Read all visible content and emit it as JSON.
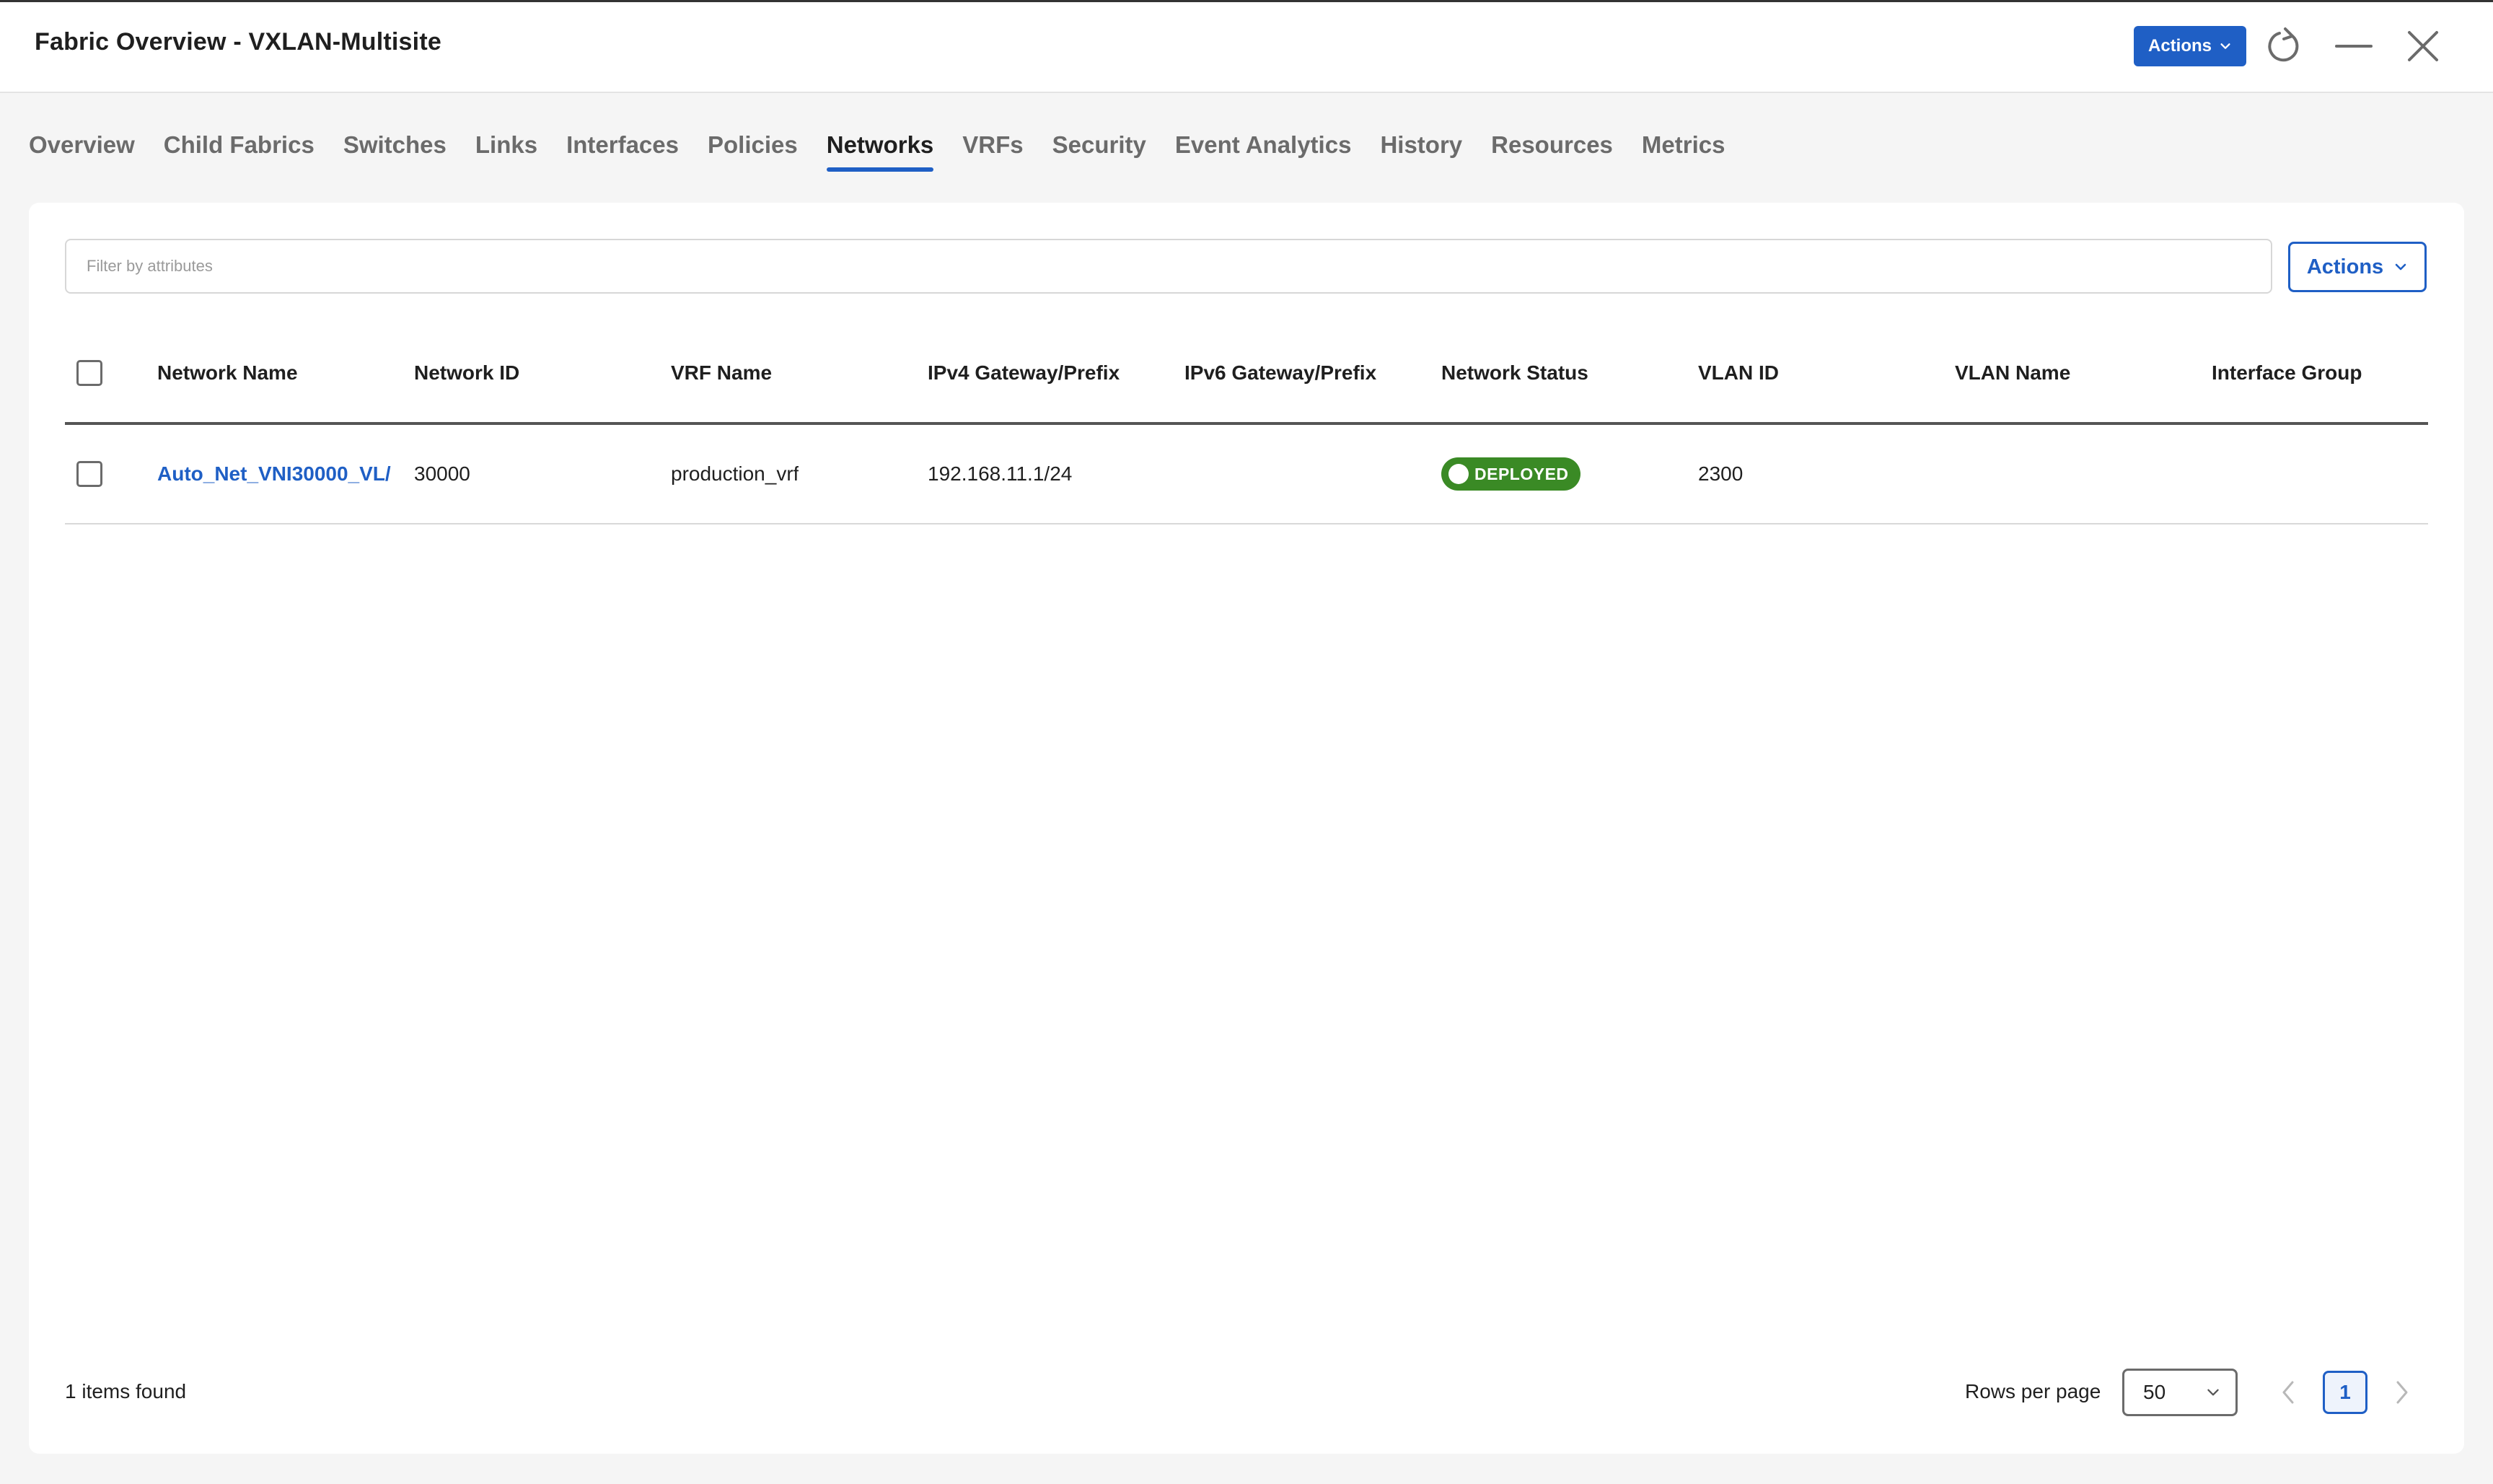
{
  "header": {
    "title": "Fabric Overview - VXLAN-Multisite",
    "actions_label": "Actions"
  },
  "tabs": [
    {
      "label": "Overview"
    },
    {
      "label": "Child Fabrics"
    },
    {
      "label": "Switches"
    },
    {
      "label": "Links"
    },
    {
      "label": "Interfaces"
    },
    {
      "label": "Policies"
    },
    {
      "label": "Networks",
      "active": true
    },
    {
      "label": "VRFs"
    },
    {
      "label": "Security"
    },
    {
      "label": "Event Analytics"
    },
    {
      "label": "History"
    },
    {
      "label": "Resources"
    },
    {
      "label": "Metrics"
    }
  ],
  "filter": {
    "placeholder": "Filter by attributes",
    "value": ""
  },
  "table_actions_label": "Actions",
  "table": {
    "columns": [
      "Network Name",
      "Network ID",
      "VRF Name",
      "IPv4 Gateway/Prefix",
      "IPv6 Gateway/Prefix",
      "Network Status",
      "VLAN ID",
      "VLAN Name",
      "Interface Group"
    ],
    "rows": [
      {
        "network_name": "Auto_Net_VNI30000_VL/",
        "network_id": "30000",
        "vrf_name": "production_vrf",
        "ipv4_gateway": "192.168.11.1/24",
        "ipv6_gateway": "",
        "network_status": "DEPLOYED",
        "vlan_id": "2300",
        "vlan_name": "",
        "interface_group": ""
      }
    ]
  },
  "footer": {
    "items_found": "1 items found",
    "rows_per_page_label": "Rows per page",
    "rows_per_page_value": "50",
    "current_page": "1"
  },
  "colors": {
    "accent": "#1f5fc5",
    "deployed": "#3a8a25"
  }
}
